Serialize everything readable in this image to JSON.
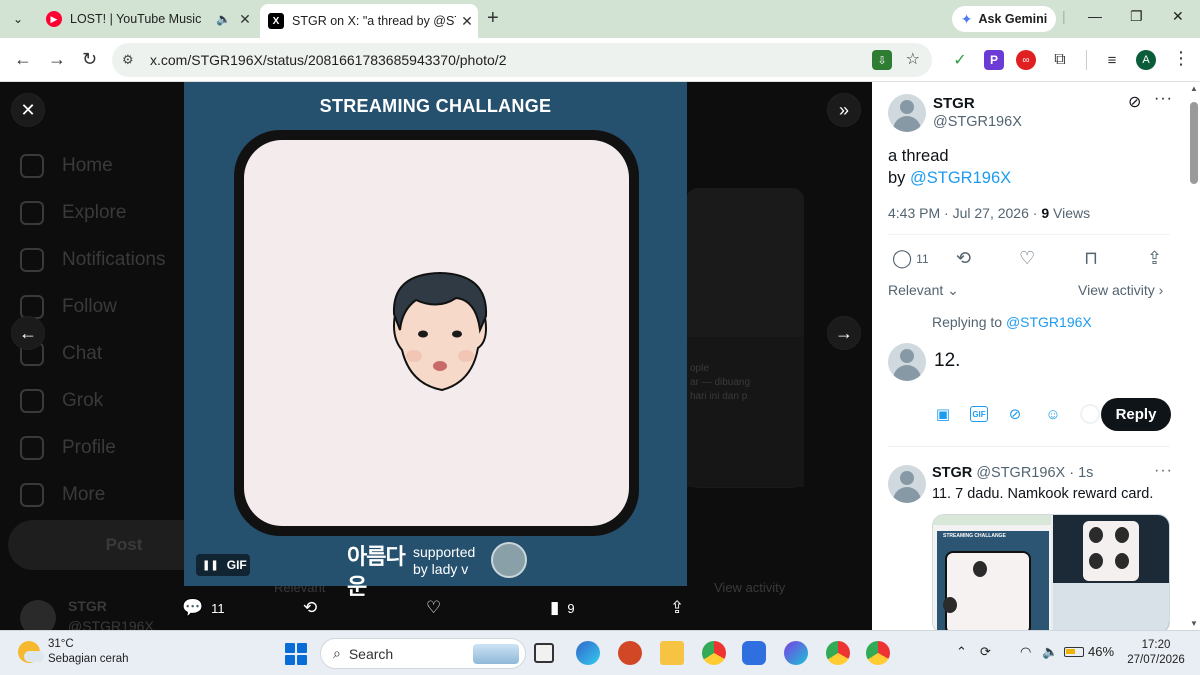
{
  "browser": {
    "tabs": [
      {
        "title": "LOST! | YouTube Music",
        "active": false
      },
      {
        "title": "STGR on X: \"a thread by @STGR",
        "active": false
      },
      {
        "title": "STGR on X: \"a thread by @STGR",
        "active": true
      }
    ],
    "new_tab": "+",
    "ask_gemini": "Ask Gemini",
    "url": "x.com/STGR196X/status/2081661783685943370/photo/2",
    "profile_initial": "A"
  },
  "viewer": {
    "ghost_nav": [
      "Home",
      "Explore",
      "Notifications",
      "Follow",
      "Chat",
      "Grok",
      "Profile",
      "More"
    ],
    "ghost_post": "Post",
    "ghost_user_name": "STGR",
    "ghost_user_handle": "@STGR196X",
    "ghost_text": "ople\nar — dibuang\nhari ini dan p",
    "ghost_relevant": "Relevant",
    "ghost_view_activity": "View activity",
    "media_title": "STREAMING CHALLANGE",
    "gif_label": "GIF",
    "supported_line1": "supported",
    "supported_line2": "by lady v",
    "logo_text": "아름다운",
    "actions": {
      "replies": "11",
      "views": "9"
    }
  },
  "panel": {
    "author_name": "STGR",
    "author_handle": "@STGR196X",
    "tweet_text_line1": "a thread",
    "tweet_text_line2_prefix": "by ",
    "tweet_text_mention": "@STGR196X",
    "timestamp": "4:43 PM · Jul 27, 2026 · ",
    "views_count": "9",
    "views_label": " Views",
    "reply_count": "11",
    "relevant": "Relevant",
    "view_activity": "View activity",
    "replying_to_prefix": "Replying to ",
    "replying_to_handle": "@STGR196X",
    "draft_text": "12.",
    "reply_button": "Reply",
    "thread_reply": {
      "name": "STGR",
      "handle": "@STGR196X",
      "time": "· 1s",
      "text": "11. 7 dadu. Namkook reward card."
    },
    "thumb_label": "STREAMING CHALLANGE"
  },
  "taskbar": {
    "temperature": "31°C",
    "weather": "Sebagian cerah",
    "search": "Search",
    "battery": "46%",
    "time": "17:20",
    "date": "27/07/2026"
  },
  "colors": {
    "media_bg": "#25506e",
    "link": "#1d9bf0",
    "reply_btn": "#0f1419"
  }
}
